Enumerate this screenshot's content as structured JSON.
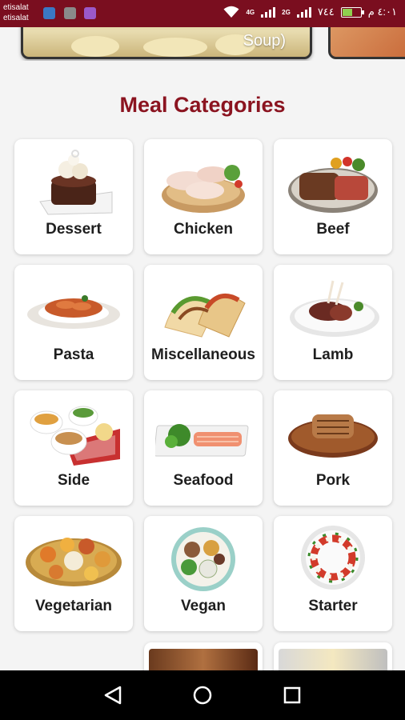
{
  "status_bar": {
    "carrier_1": "etisalat",
    "carrier_2": "etisalat",
    "net_1": "4G",
    "net_2": "2G",
    "battery_percent": "٧٤٤",
    "time": "٤:٠١ م",
    "battery_level": 0.5
  },
  "carousel": {
    "caption": "Soup)"
  },
  "section": {
    "title": "Meal Categories"
  },
  "categories": [
    {
      "label": "Dessert",
      "icon": "dessert-icon"
    },
    {
      "label": "Chicken",
      "icon": "chicken-icon"
    },
    {
      "label": "Beef",
      "icon": "beef-icon"
    },
    {
      "label": "Pasta",
      "icon": "pasta-icon"
    },
    {
      "label": "Miscellaneous",
      "icon": "taco-icon"
    },
    {
      "label": "Lamb",
      "icon": "lamb-icon"
    },
    {
      "label": "Side",
      "icon": "side-icon"
    },
    {
      "label": "Seafood",
      "icon": "seafood-icon"
    },
    {
      "label": "Pork",
      "icon": "pork-icon"
    },
    {
      "label": "Vegetarian",
      "icon": "vegetarian-icon"
    },
    {
      "label": "Vegan",
      "icon": "vegan-icon"
    },
    {
      "label": "Starter",
      "icon": "starter-icon"
    }
  ],
  "colors": {
    "status_bar": "#7a0e1f",
    "title": "#8b1420",
    "background": "#f4f4f4"
  }
}
